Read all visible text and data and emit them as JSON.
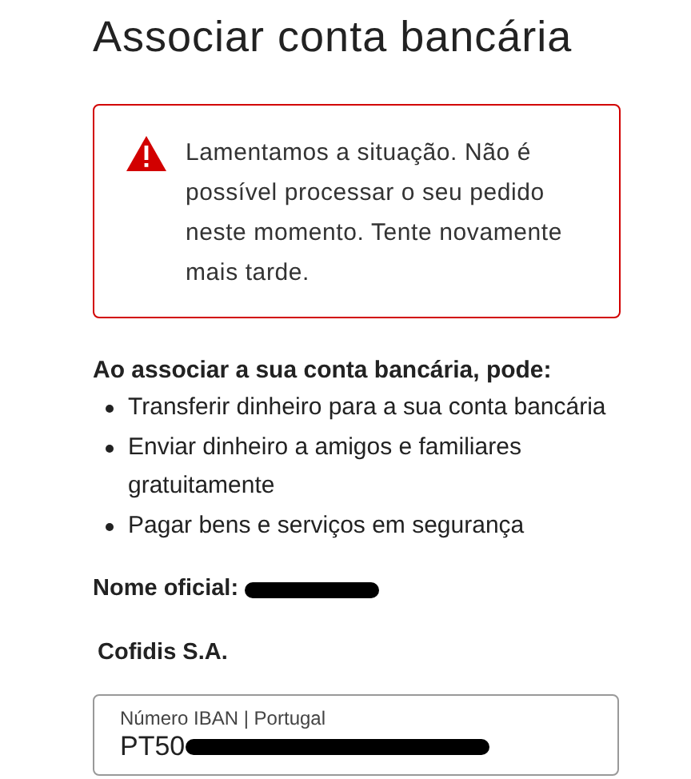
{
  "title": "Associar conta bancária",
  "alert": {
    "message": "Lamentamos a situação. Não é possível processar o seu pedido neste momento. Tente novamente mais tarde."
  },
  "benefits": {
    "heading": "Ao associar a sua conta bancária, pode:",
    "items": [
      "Transferir dinheiro para a sua conta bancária",
      "Enviar dinheiro a amigos e familiares gratuitamente",
      "Pagar bens e serviços em segurança"
    ]
  },
  "official_name": {
    "label": "Nome oficial:"
  },
  "bank_name": "Cofidis S.A.",
  "iban_field": {
    "label": "Número IBAN | Portugal",
    "value": "PT50"
  }
}
